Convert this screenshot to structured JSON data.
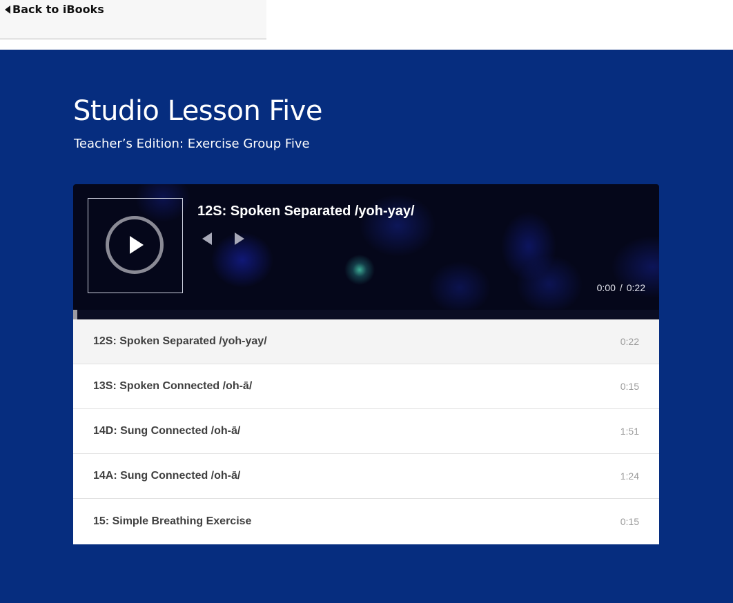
{
  "nav": {
    "back_label": "Back to iBooks"
  },
  "page": {
    "title": "Studio Lesson Five",
    "subtitle": "Teacher’s Edition: Exercise Group Five"
  },
  "player": {
    "current_track": "12S: Spoken Separated /yoh-yay/",
    "current_time": "0:00",
    "separator": "/",
    "total_time": "0:22",
    "progress_fraction": 0.0
  },
  "playlist": [
    {
      "label": "12S: Spoken Separated /yoh-yay/",
      "duration": "0:22",
      "active": true
    },
    {
      "label": "13S: Spoken Connected /oh-ā/",
      "duration": "0:15",
      "active": false
    },
    {
      "label": "14D: Sung Connected /oh-ā/",
      "duration": "1:51",
      "active": false
    },
    {
      "label": "14A: Sung Connected /oh-ā/",
      "duration": "1:24",
      "active": false
    },
    {
      "label": "15: Simple Breathing Exercise",
      "duration": "0:15",
      "active": false
    }
  ],
  "colors": {
    "page_background": "#062d7f",
    "player_background": "#05071a",
    "active_row": "#f4f4f4"
  },
  "icons": {
    "back": "caret-left-icon",
    "play": "play-icon",
    "prev": "previous-track-icon",
    "next": "next-track-icon"
  }
}
